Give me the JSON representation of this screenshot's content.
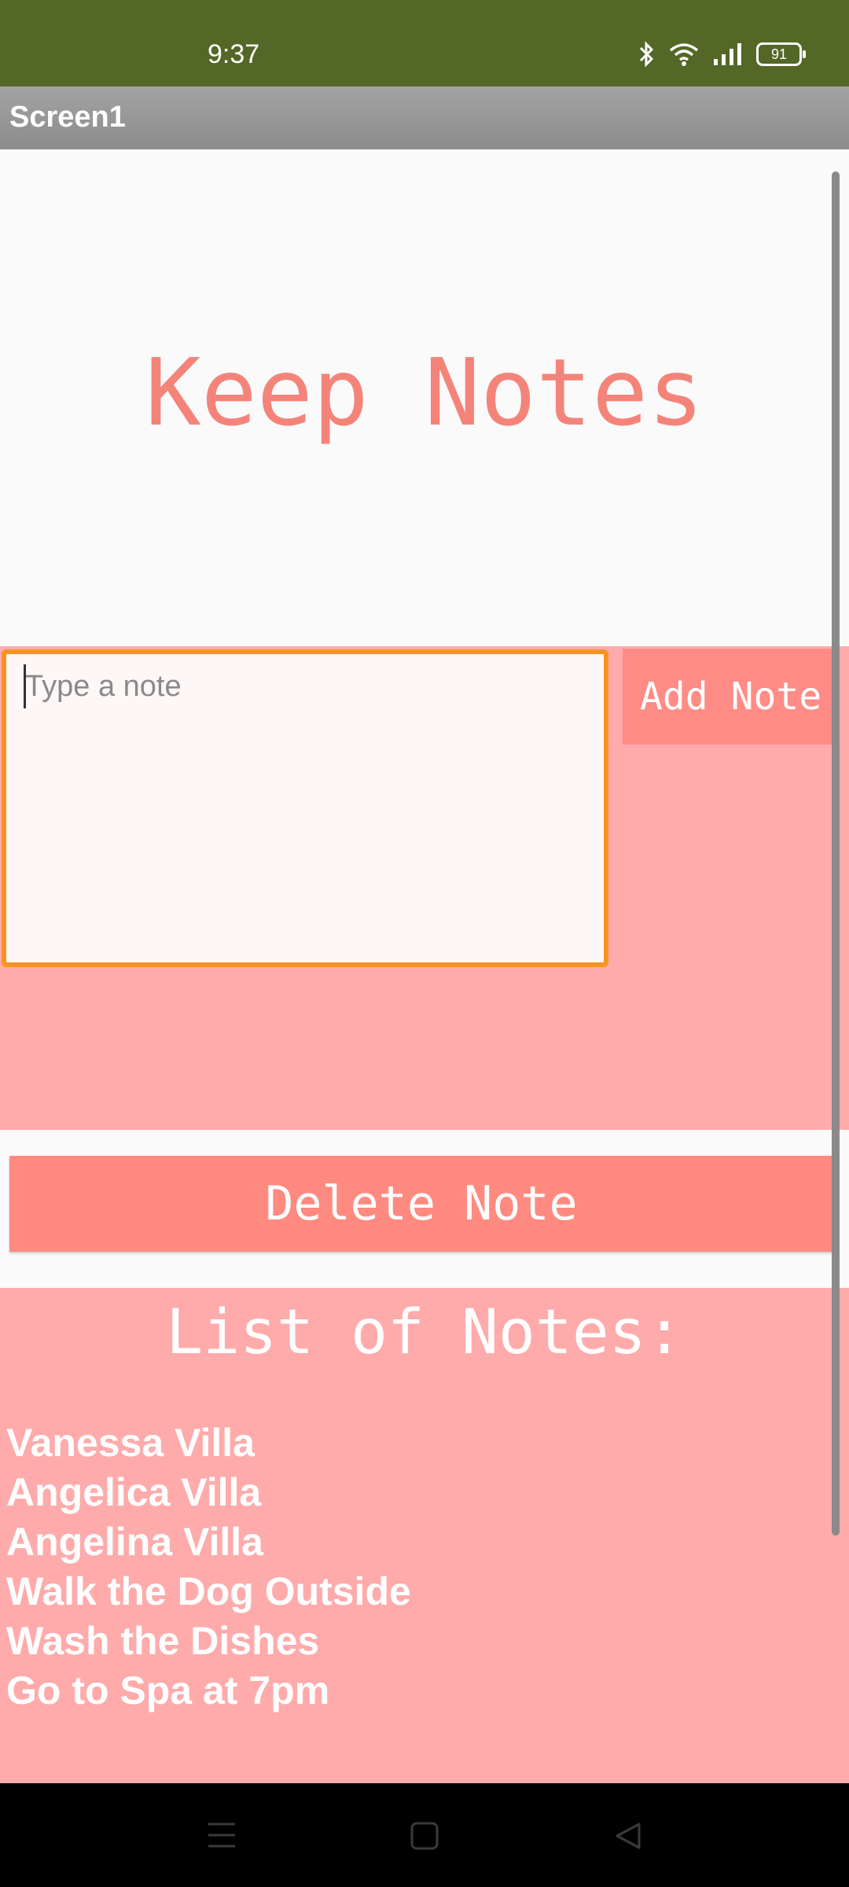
{
  "status_bar": {
    "time": "9:37",
    "battery": "91",
    "icons": [
      "bluetooth-icon",
      "wifi-icon",
      "signal-icon",
      "battery-icon"
    ]
  },
  "title_bar": {
    "title": "Screen1"
  },
  "app": {
    "heading": "Keep Notes",
    "input": {
      "placeholder": "Type a note",
      "value": ""
    },
    "add_button": "Add Note",
    "delete_button": "Delete Note",
    "list_title": "List of Notes:",
    "notes": [
      "Vanessa Villa",
      "Angelica Villa",
      "Angelina Villa",
      "Walk the Dog Outside",
      "Wash the Dishes",
      "Go to Spa at 7pm"
    ]
  },
  "colors": {
    "status_bar": "#536727",
    "accent_pink": "#ffabab",
    "button_salmon": "#ff8a80",
    "heading_color": "#f4847a",
    "input_border": "#f79322"
  },
  "nav_bar": {
    "icons": [
      "menu-icon",
      "home-icon",
      "back-icon"
    ]
  }
}
